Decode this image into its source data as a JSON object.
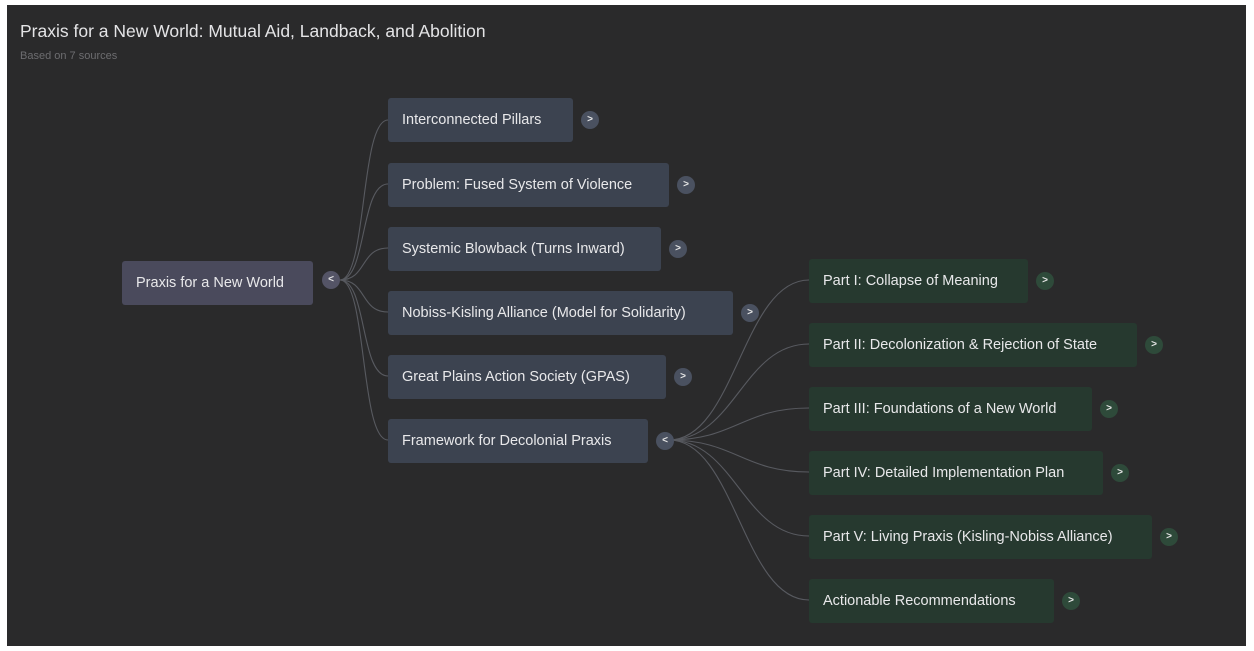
{
  "header": {
    "title": "Praxis for a New World: Mutual Aid, Landback, and Abolition",
    "subtitle": "Based on 7 sources"
  },
  "mindmap": {
    "root": {
      "label": "Praxis for a New World",
      "toggle": "<"
    },
    "level1": [
      {
        "label": "Interconnected Pillars",
        "toggle": ">"
      },
      {
        "label": "Problem: Fused System of Violence",
        "toggle": ">"
      },
      {
        "label": "Systemic Blowback (Turns Inward)",
        "toggle": ">"
      },
      {
        "label": "Nobiss-Kisling Alliance (Model for Solidarity)",
        "toggle": ">"
      },
      {
        "label": "Great Plains Action Society (GPAS)",
        "toggle": ">"
      },
      {
        "label": "Framework for Decolonial Praxis",
        "toggle": "<"
      }
    ],
    "level2": [
      {
        "label": "Part I: Collapse of Meaning",
        "toggle": ">"
      },
      {
        "label": "Part II: Decolonization & Rejection of State",
        "toggle": ">"
      },
      {
        "label": "Part III: Foundations of a New World",
        "toggle": ">"
      },
      {
        "label": "Part IV: Detailed Implementation Plan",
        "toggle": ">"
      },
      {
        "label": "Part V: Living Praxis (Kisling-Nobiss Alliance)",
        "toggle": ">"
      },
      {
        "label": "Actionable Recommendations",
        "toggle": ">"
      }
    ]
  },
  "colors": {
    "background": "#2a2a2b",
    "root_node": "#4a4a5c",
    "level1_node": "#3c4350",
    "level2_node": "#26392f",
    "connector": "#585a60"
  }
}
